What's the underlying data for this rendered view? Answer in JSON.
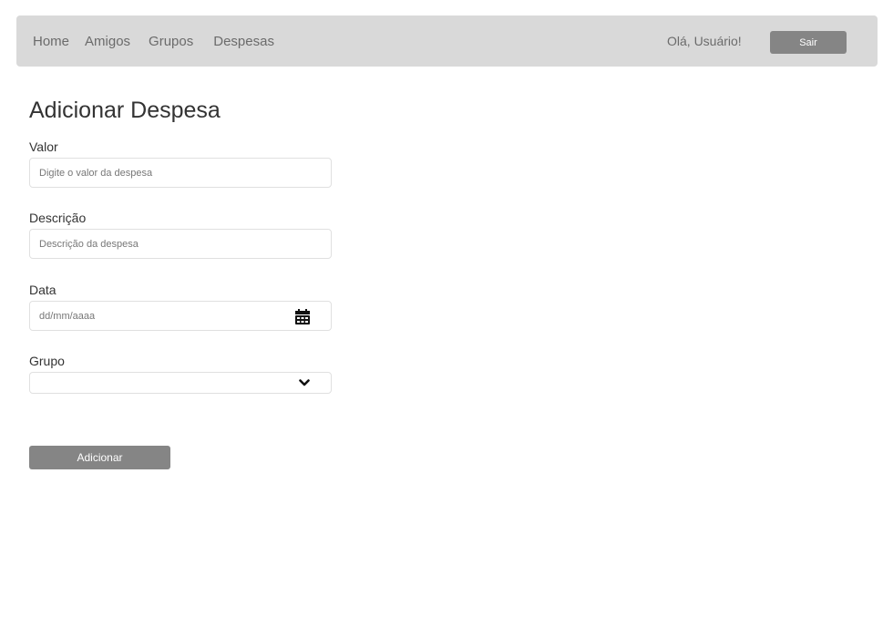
{
  "nav": {
    "links": [
      "Home",
      "Amigos",
      "Grupos",
      "Despesas"
    ],
    "greeting": "Olá, Usuário!",
    "logout_label": "Sair"
  },
  "form": {
    "title": "Adicionar Despesa",
    "valor": {
      "label": "Valor",
      "placeholder": "Digite o valor da despesa",
      "value": ""
    },
    "descricao": {
      "label": "Descrição",
      "placeholder": "Descrição da despesa",
      "value": ""
    },
    "data": {
      "label": "Data",
      "placeholder": "dd/mm/aaaa",
      "icon": "calendar-icon"
    },
    "grupo": {
      "label": "Grupo",
      "selected": "",
      "icon": "chevron-down-icon"
    },
    "submit_label": "Adicionar"
  },
  "colors": {
    "navbar_bg": "#d9d9d9",
    "button_bg": "#858585"
  }
}
